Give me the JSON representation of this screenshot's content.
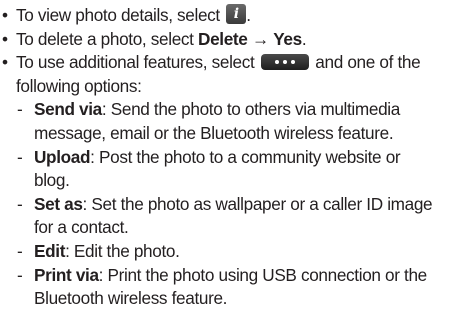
{
  "bullets": [
    {
      "before": "To view photo details, select ",
      "icon": "info-icon",
      "after": "."
    },
    {
      "before": "To delete a photo, select ",
      "b1": "Delete",
      "arrow": " → ",
      "b2": "Yes",
      "after": "."
    },
    {
      "before": "To use additional features, select ",
      "icon": "more-options-icon",
      "after": " and one of the",
      "line2": "following options:"
    }
  ],
  "options": [
    {
      "term": "Send via",
      "desc1": ": Send the photo to others via multimedia",
      "desc2": "message, email or the Bluetooth wireless feature."
    },
    {
      "term": "Upload",
      "desc1": ": Post the photo to a community website or",
      "desc2": "blog."
    },
    {
      "term": "Set as",
      "desc1": ": Set the photo as wallpaper or a caller ID image",
      "desc2": "for a contact."
    },
    {
      "term": "Edit",
      "desc1": ": Edit the photo."
    },
    {
      "term": "Print via",
      "desc1": ": Print the photo using USB connection or the",
      "desc2": "Bluetooth wireless feature."
    }
  ],
  "markers": {
    "bullet": "•",
    "dash": "-"
  }
}
